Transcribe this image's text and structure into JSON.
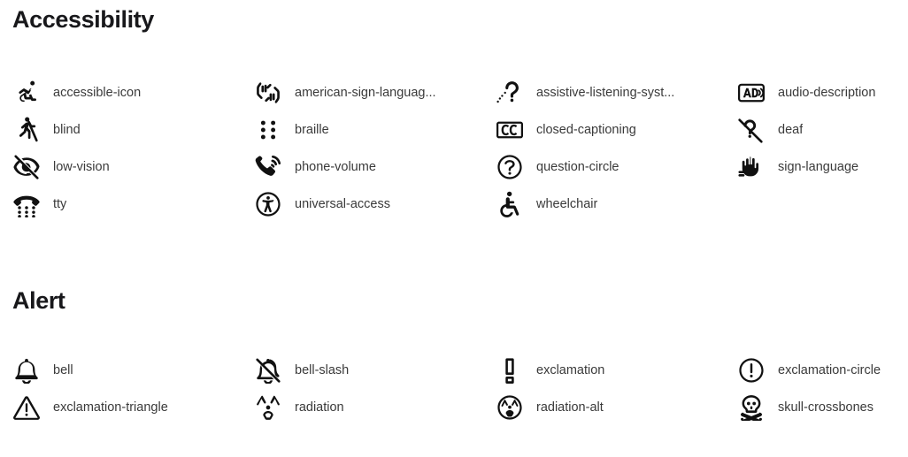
{
  "sections": [
    {
      "title": "Accessibility",
      "icons": [
        {
          "icon": "accessible-icon",
          "label": "accessible-icon"
        },
        {
          "icon": "american-sign-language-interpreting-icon",
          "label": "american-sign-languag..."
        },
        {
          "icon": "assistive-listening-systems-icon",
          "label": "assistive-listening-syst..."
        },
        {
          "icon": "audio-description-icon",
          "label": "audio-description"
        },
        {
          "icon": "blind-icon",
          "label": "blind"
        },
        {
          "icon": "braille-icon",
          "label": "braille"
        },
        {
          "icon": "closed-captioning-icon",
          "label": "closed-captioning"
        },
        {
          "icon": "deaf-icon",
          "label": "deaf"
        },
        {
          "icon": "low-vision-icon",
          "label": "low-vision"
        },
        {
          "icon": "phone-volume-icon",
          "label": "phone-volume"
        },
        {
          "icon": "question-circle-icon",
          "label": "question-circle"
        },
        {
          "icon": "sign-language-icon",
          "label": "sign-language"
        },
        {
          "icon": "tty-icon",
          "label": "tty"
        },
        {
          "icon": "universal-access-icon",
          "label": "universal-access"
        },
        {
          "icon": "wheelchair-icon",
          "label": "wheelchair"
        }
      ]
    },
    {
      "title": "Alert",
      "icons": [
        {
          "icon": "bell-icon",
          "label": "bell"
        },
        {
          "icon": "bell-slash-icon",
          "label": "bell-slash"
        },
        {
          "icon": "exclamation-icon",
          "label": "exclamation"
        },
        {
          "icon": "exclamation-circle-icon",
          "label": "exclamation-circle"
        },
        {
          "icon": "exclamation-triangle-icon",
          "label": "exclamation-triangle"
        },
        {
          "icon": "radiation-icon",
          "label": "radiation"
        },
        {
          "icon": "radiation-alt-icon",
          "label": "radiation-alt"
        },
        {
          "icon": "skull-crossbones-icon",
          "label": "skull-crossbones"
        }
      ]
    }
  ],
  "colors": {
    "background": "#ffffff",
    "heading": "#18181b",
    "label": "#3a3a3a",
    "icon": "#111111"
  }
}
